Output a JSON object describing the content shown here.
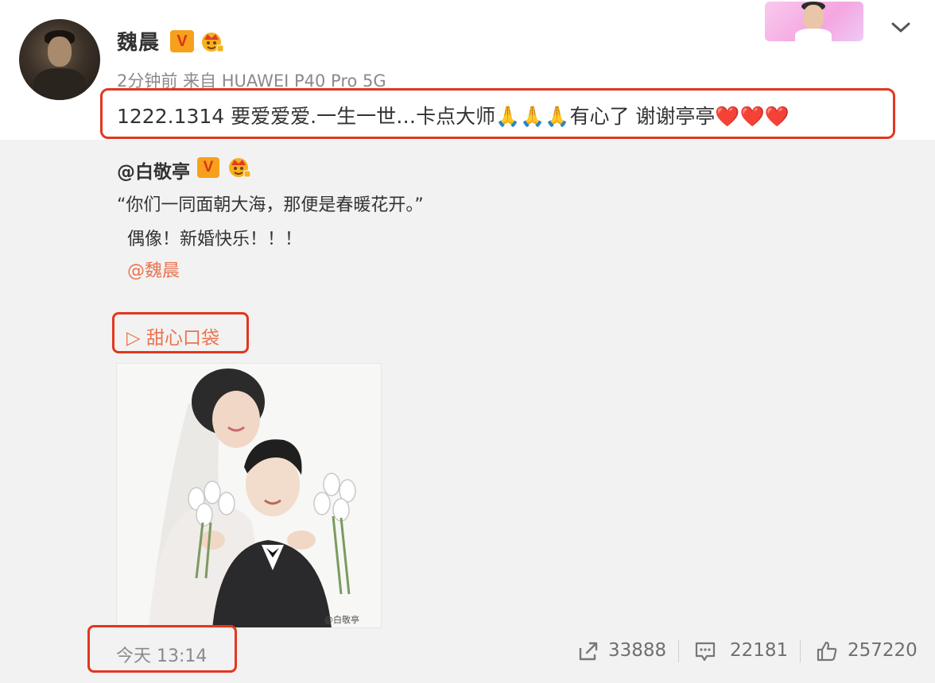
{
  "post": {
    "author": "魏晨",
    "meta": "2分钟前 来自 HUAWEI P40 Pro 5G",
    "content": "1222.1314  要爱爱爱.一生一世…卡点大师🙏🙏🙏有心了 谢谢亭亭❤️❤️❤️",
    "verified_badge": "V",
    "timestamp": "今天 13:14"
  },
  "repost": {
    "author": "@白敬亭",
    "verified_badge": "V",
    "line1": "“你们一同面朝大海，那便是春暖花开。”",
    "line2": "偶像！新婚快乐！！！",
    "mention": "@魏晨",
    "music": "▷ 甜心口袋",
    "image_watermark": "@白敬亭"
  },
  "actions": {
    "share_count": "33888",
    "comment_count": "22181",
    "like_count": "257220"
  },
  "colors": {
    "highlight": "#e2371f",
    "link": "#eb7350",
    "badge": "#f7a01c",
    "repost_bg": "#f2f2f2"
  }
}
